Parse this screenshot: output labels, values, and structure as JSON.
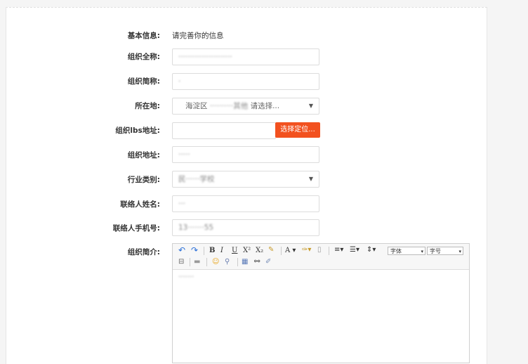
{
  "form": {
    "basic_info": {
      "label": "基本信息:",
      "value": "请完善你的信息"
    },
    "org_full_name": {
      "label": "组织全称:",
      "value": "·······················"
    },
    "org_short_name": {
      "label": "组织简称:",
      "value": "·"
    },
    "location": {
      "label": "所在地:",
      "value": "海淀区",
      "value_blurred": "··········其他",
      "placeholder": "请选择..."
    },
    "lbs_address": {
      "label": "组织lbs地址:",
      "value": "",
      "button_label": "选择定位..."
    },
    "org_address": {
      "label": "组织地址:",
      "value": "·····"
    },
    "industry": {
      "label": "行业类别:",
      "value": "民······学校"
    },
    "contact_name": {
      "label": "联络人姓名:",
      "value": "···"
    },
    "contact_phone": {
      "label": "联络人手机号:",
      "value": "13·······55"
    },
    "intro": {
      "label": "组织简介:"
    }
  },
  "editor": {
    "font_family_label": "字体",
    "font_size_label": "字号",
    "content": "·······"
  },
  "icons": {
    "undo": "undo-icon",
    "redo": "redo-icon",
    "bold": "bold-icon",
    "italic": "italic-icon",
    "underline": "underline-icon",
    "superscript": "superscript-icon",
    "subscript": "subscript-icon",
    "eraser": "eraser-icon",
    "font_color": "font-color-icon",
    "highlight": "highlight-icon",
    "paste": "paste-icon",
    "align": "align-icon",
    "list": "list-icon",
    "line_height": "line-height-icon",
    "hr": "horizontal-rule-icon",
    "emoji": "emoji-icon",
    "link": "link-icon",
    "table": "table-icon",
    "find": "find-icon",
    "clear": "clear-format-icon"
  },
  "colors": {
    "accent": "#f2511f",
    "link_blue": "#2a6fd8"
  }
}
